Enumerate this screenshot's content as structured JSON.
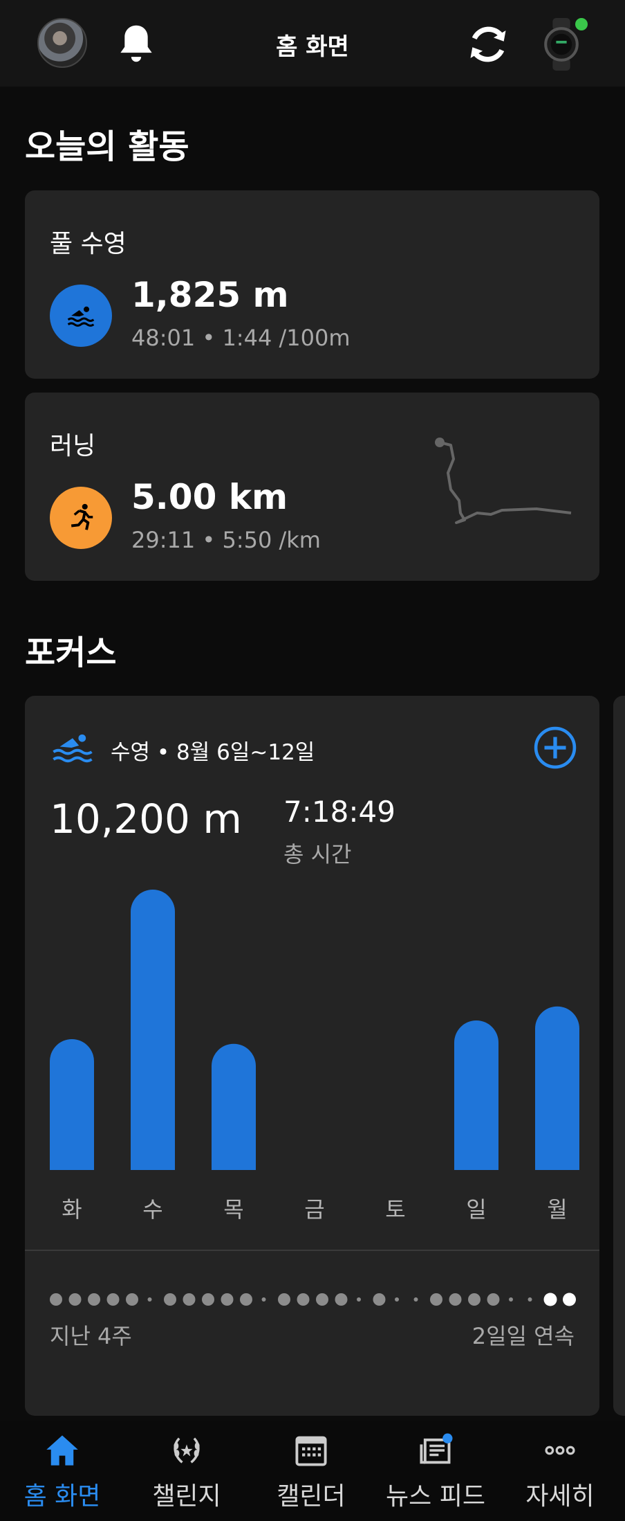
{
  "header": {
    "title": "홈 화면"
  },
  "today": {
    "section_title": "오늘의 활동",
    "activities": [
      {
        "label": "풀 수영",
        "value": "1,825 m",
        "details": "48:01 • 1:44 /100m",
        "color": "#1f75d9",
        "icon": "swimmer-icon"
      },
      {
        "label": "러닝",
        "value": "5.00 km",
        "details": "29:11 • 5:50 /km",
        "color": "#f79a35",
        "icon": "runner-icon"
      }
    ]
  },
  "focus": {
    "section_title": "포커스",
    "header_text": "수영 • 8월 6일~12일",
    "distance": "10,200 m",
    "total_time": "7:18:49",
    "total_time_label": "총 시간",
    "last_weeks_label": "지난 4주",
    "streak_label": "2일일 연속",
    "accent": "#1f75d9"
  },
  "chart_data": {
    "type": "bar",
    "categories": [
      "화",
      "수",
      "목",
      "금",
      "토",
      "일",
      "월"
    ],
    "values": [
      1400,
      3000,
      1350,
      0,
      0,
      1600,
      1750
    ],
    "ylim": [
      0,
      3000
    ]
  },
  "nav": {
    "items": [
      {
        "label": "홈 화면",
        "icon": "home-icon",
        "active": true
      },
      {
        "label": "챌린지",
        "icon": "laurel-icon",
        "active": false
      },
      {
        "label": "캘린더",
        "icon": "calendar-icon",
        "active": false
      },
      {
        "label": "뉴스 피드",
        "icon": "news-icon",
        "active": false
      },
      {
        "label": "자세히",
        "icon": "more-icon",
        "active": false
      }
    ]
  }
}
